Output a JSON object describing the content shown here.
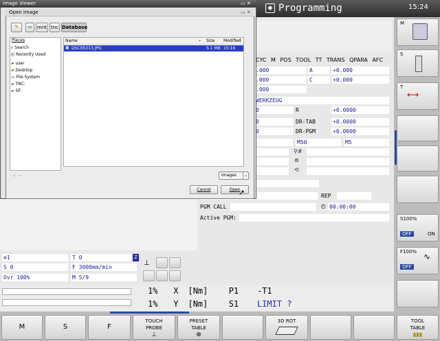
{
  "header": {
    "mode_title": "Programming",
    "clock": "15:24"
  },
  "viewer": {
    "title": "Image Viewer"
  },
  "dialog": {
    "title": "Open image",
    "path": [
      "mnt",
      "tnc",
      "Database"
    ],
    "places_header": "Places",
    "places": [
      "Search",
      "Recently Used",
      "user",
      "Desktop",
      "File System",
      "TNC:",
      "SF:"
    ],
    "columns": {
      "name": "Name",
      "size": "Size",
      "modified": "Modified"
    },
    "files": [
      {
        "name": "DSC05313.JPG",
        "size": "5.1 MB",
        "modified": "15:16"
      }
    ],
    "filter": "Images",
    "cancel": "Cancel",
    "open": "Open"
  },
  "status_tabs": [
    "CYC",
    "M",
    "POS",
    "TOOL",
    "TT",
    "TRANS",
    "QPARA",
    "AFC"
  ],
  "status_rows": {
    "r1_left": ".000",
    "r1_axis": "A",
    "r1_val": "+0.000",
    "r2_left": ".000",
    "r2_axis": "C",
    "r2_val": "+0.000",
    "r3_left": ".000",
    "werkzeug": "WERKZEUG",
    "r5_left": "0",
    "r5_lbl": "R",
    "r5_val": "+0.0000",
    "r6_left": "0",
    "r6_lbl": "DR-TAB",
    "r6_val": "+0.0000",
    "r7_left": "0",
    "r7_lbl": "DR-PGM",
    "r7_val": "+0.0000",
    "m50": "M50",
    "m5": "M5",
    "hash": "#",
    "rep": "REP",
    "pgm_call": "PGM CALL",
    "timer": "00:00:00",
    "active_pgm": "Active PGM:"
  },
  "bottom_left": {
    "axis1": "1",
    "tool": "T 0",
    "s": "S 0",
    "feed": "F 3000mm/min",
    "ovr": "Ovr 100%",
    "m": "M 5/9",
    "z_badge": "Z"
  },
  "readout": [
    {
      "pct": "1%",
      "axis": "X",
      "unit": "[Nm]",
      "p": "P1",
      "val": "-T1"
    },
    {
      "pct": "1%",
      "axis": "Y",
      "unit": "[Nm]",
      "p": "S1",
      "val": "LIMIT ?"
    }
  ],
  "vertical_softkeys": {
    "m_label": "M",
    "s_label": "S",
    "t_label": "T",
    "s100": "S100%",
    "f100": "F100%",
    "off": "OFF",
    "on": "ON"
  },
  "softkeys": {
    "m": "M",
    "s": "S",
    "f": "F",
    "touch_probe": [
      "TOUCH",
      "PROBE"
    ],
    "preset_table": [
      "PRESET",
      "TABLE"
    ],
    "rot_3d": "3D ROT",
    "tool_table": [
      "TOOL",
      "TABLE"
    ]
  }
}
